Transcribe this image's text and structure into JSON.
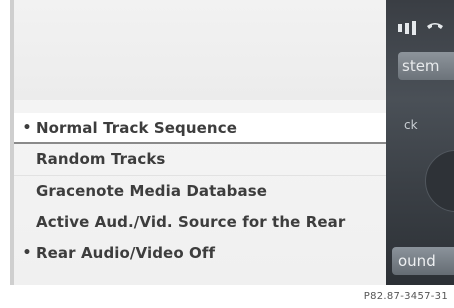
{
  "background": {
    "top_item_label": "stem",
    "mid_item_label": "ck",
    "bottom_item_label": "ound",
    "status_icons": [
      "signal-icon",
      "phone-icon"
    ]
  },
  "menu": {
    "items": [
      {
        "label": "Normal Track Sequence",
        "active": true,
        "highlighted": true
      },
      {
        "label": "Random Tracks",
        "active": false,
        "highlighted": false
      },
      {
        "label": "Gracenote Media Database",
        "active": false,
        "highlighted": false
      },
      {
        "label": "Active Aud./Vid. Source for the Rear",
        "active": false,
        "highlighted": false
      },
      {
        "label": "Rear Audio/Video Off",
        "active": true,
        "highlighted": false
      }
    ],
    "bullet_glyph": "•"
  },
  "caption": "P82.87-3457-31",
  "colors": {
    "menu_bg": "#f3f3f3",
    "text": "#3d3d3d",
    "highlight_underline": "#8a8a8a",
    "dark_bg": "#3a3e44"
  }
}
